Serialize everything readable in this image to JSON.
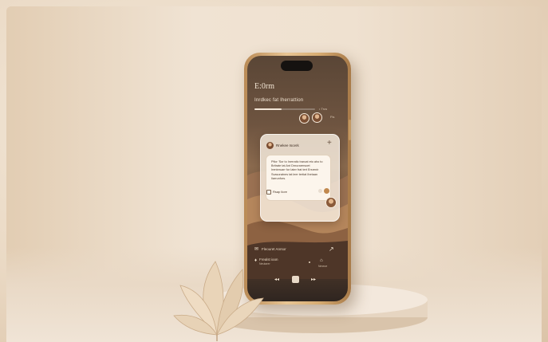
{
  "phone": {
    "time": "E:0rm",
    "headline": "Inrdkec fat Iherrattion",
    "progress_fraction": 0.45,
    "progress_label": "• Trcs",
    "mini_label": "Fis"
  },
  "card": {
    "title": "Rnekee Iscerk",
    "plus_icon": "plus-icon",
    "body": "Pflor 'Sor to Inerratic traroat eto aho to\nBritrate tat Ant  Drnurarersoet\nIrenteruarr for Iater frat tert Ersrenir\nSvasoratnes tat leer tertiat Ihetaan\nIiarrunfors.",
    "footer_label": "Rsap liore",
    "accent_color": "#c1894f"
  },
  "controls": {
    "row1_label": "Fleouret Anrsor",
    "row1_right": "↗",
    "row2_label": "Frealst ioon",
    "row2_sub": "Neutarer",
    "home_label": "Nmeoe",
    "prev_icon": "rewind-icon",
    "next_icon": "fast-forward-icon"
  },
  "colors": {
    "phone_gold": "#d7ac72",
    "background": "#f1e6d8",
    "screen_text": "#f1e4d3"
  }
}
